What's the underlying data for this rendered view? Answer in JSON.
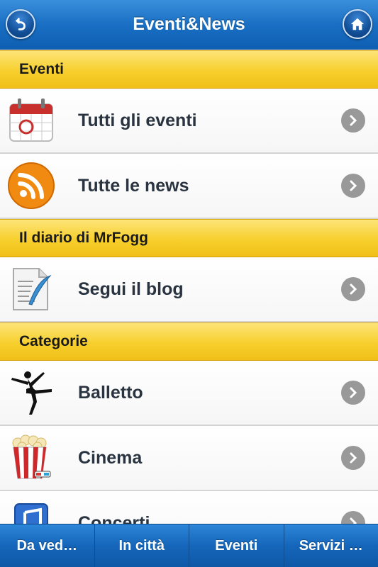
{
  "navbar": {
    "title": "Eventi&News",
    "back_icon": "back-arrow-icon",
    "home_icon": "home-icon"
  },
  "sections": [
    {
      "header": "Eventi",
      "items": [
        {
          "label": "Tutti gli eventi",
          "icon": "calendar-icon"
        },
        {
          "label": "Tutte le news",
          "icon": "rss-icon"
        }
      ]
    },
    {
      "header": "Il diario di MrFogg",
      "items": [
        {
          "label": "Segui il blog",
          "icon": "blog-document-icon"
        }
      ]
    },
    {
      "header": "Categorie",
      "items": [
        {
          "label": "Balletto",
          "icon": "ballet-dancer-icon"
        },
        {
          "label": "Cinema",
          "icon": "popcorn-icon"
        },
        {
          "label": "Concerti",
          "icon": "music-note-icon"
        }
      ]
    }
  ],
  "tabbar": {
    "tabs": [
      {
        "label": "Da ved…"
      },
      {
        "label": "In città"
      },
      {
        "label": "Eventi"
      },
      {
        "label": "Servizi …"
      }
    ]
  },
  "colors": {
    "navbar_blue": "#1a6fc4",
    "section_yellow": "#f7cf2c",
    "chevron_gray": "#999999",
    "label_text": "#2a3440"
  }
}
